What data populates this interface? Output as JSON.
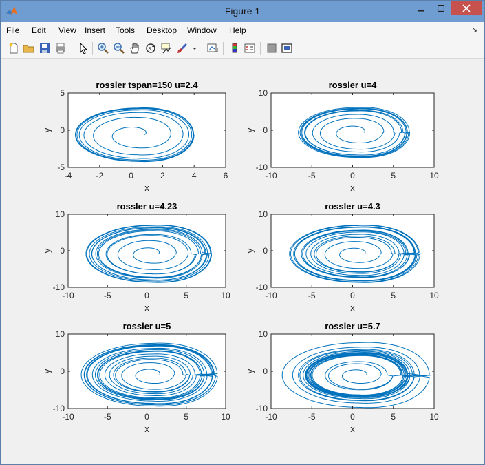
{
  "window": {
    "title": "Figure 1"
  },
  "menu": [
    "File",
    "Edit",
    "View",
    "Insert",
    "Tools",
    "Desktop",
    "Window",
    "Help"
  ],
  "toolbar_icons": [
    "new-figure-icon",
    "open-file-icon",
    "save-icon",
    "print-icon",
    "edit-plot-icon",
    "zoom-in-icon",
    "zoom-out-icon",
    "pan-icon",
    "rotate-3d-icon",
    "data-cursor-icon",
    "brush-icon",
    "link-plot-icon",
    "colorbar-icon",
    "legend-icon",
    "hide-plot-tools-icon",
    "show-plot-tools-icon"
  ],
  "colors": {
    "line": "#0072bd",
    "titlebar": "#6f9cd1",
    "close": "#c7514c"
  },
  "chart_data": [
    {
      "type": "line",
      "title": "rossler  tspan=150  u=2.4",
      "xlabel": "x",
      "ylabel": "y",
      "xlim": [
        -4,
        6
      ],
      "ylim": [
        -5,
        5
      ],
      "xticks": [
        "-4",
        "-2",
        "0",
        "2",
        "4",
        "6"
      ],
      "yticks": [
        "5",
        "0",
        "-5"
      ],
      "series": [
        {
          "description": "phase portrait y vs x, spiral outward to a period-1 limit cycle",
          "cx": 0.35,
          "cy": -0.6,
          "rx_start": 0.5,
          "rx_end": 3.9,
          "ry_ratio": 0.92,
          "turns": 7,
          "loops": 1,
          "dispersion": 0.05,
          "start": [
            0,
            1
          ]
        }
      ]
    },
    {
      "type": "line",
      "title": "rossler   u=4",
      "xlabel": "x",
      "ylabel": "y",
      "xlim": [
        -10,
        10
      ],
      "ylim": [
        -10,
        10
      ],
      "xticks": [
        "-10",
        "-5",
        "0",
        "5",
        "10"
      ],
      "yticks": [
        "10",
        "0",
        "-10"
      ],
      "series": [
        {
          "description": "phase portrait y vs x, period-2 attractor",
          "cx": 0.4,
          "cy": -0.6,
          "rx_start": 1.0,
          "rx_end": 6.6,
          "ry_ratio": 0.95,
          "turns": 9,
          "loops": 2,
          "dispersion": 0.18,
          "start": [
            0,
            0
          ]
        }
      ]
    },
    {
      "type": "line",
      "title": "rossler   u=4.23",
      "xlabel": "x",
      "ylabel": "y",
      "xlim": [
        -10,
        10
      ],
      "ylim": [
        -10,
        10
      ],
      "xticks": [
        "-10",
        "-5",
        "0",
        "5",
        "10"
      ],
      "yticks": [
        "10",
        "0",
        "-10"
      ],
      "series": [
        {
          "description": "phase portrait y vs x, period-4 attractor",
          "cx": 0.5,
          "cy": -0.8,
          "rx_start": 1.0,
          "rx_end": 7.3,
          "ry_ratio": 0.95,
          "turns": 12,
          "loops": 4,
          "dispersion": 0.3,
          "start": [
            0,
            0
          ]
        }
      ]
    },
    {
      "type": "line",
      "title": "rossler   u=4.3",
      "xlabel": "x",
      "ylabel": "y",
      "xlim": [
        -10,
        10
      ],
      "ylim": [
        -10,
        10
      ],
      "xticks": [
        "-10",
        "-5",
        "0",
        "5",
        "10"
      ],
      "yticks": [
        "10",
        "0",
        "-10"
      ],
      "series": [
        {
          "description": "phase portrait y vs x, higher-period attractor",
          "cx": 0.5,
          "cy": -0.8,
          "rx_start": 1.0,
          "rx_end": 7.4,
          "ry_ratio": 0.95,
          "turns": 14,
          "loops": 8,
          "dispersion": 0.35,
          "start": [
            0,
            0
          ]
        }
      ]
    },
    {
      "type": "line",
      "title": "rossler   u=5",
      "xlabel": "x",
      "ylabel": "y",
      "xlim": [
        -10,
        10
      ],
      "ylim": [
        -10,
        10
      ],
      "xticks": [
        "-10",
        "-5",
        "0",
        "5",
        "10"
      ],
      "yticks": [
        "10",
        "0",
        "-10"
      ],
      "series": [
        {
          "description": "phase portrait y vs x, chaotic band",
          "cx": 0.6,
          "cy": -0.9,
          "rx_start": 1.0,
          "rx_end": 7.8,
          "ry_ratio": 0.94,
          "turns": 16,
          "loops": 16,
          "dispersion": 0.45,
          "start": [
            0,
            0
          ]
        }
      ]
    },
    {
      "type": "line",
      "title": "rossler   u=5.7",
      "xlabel": "x",
      "ylabel": "y",
      "xlim": [
        -10,
        10
      ],
      "ylim": [
        -10,
        10
      ],
      "xticks": [
        "-10",
        "-5",
        "0",
        "5",
        "10"
      ],
      "yticks": [
        "10",
        "0",
        "-10"
      ],
      "series": [
        {
          "description": "phase portrait y vs x, chaotic Rossler attractor",
          "cx": 0.7,
          "cy": -1.0,
          "rx_start": 1.0,
          "rx_end": 8.0,
          "ry_ratio": 0.93,
          "turns": 18,
          "loops": 32,
          "dispersion": 0.55,
          "start": [
            0,
            0
          ]
        }
      ]
    }
  ]
}
